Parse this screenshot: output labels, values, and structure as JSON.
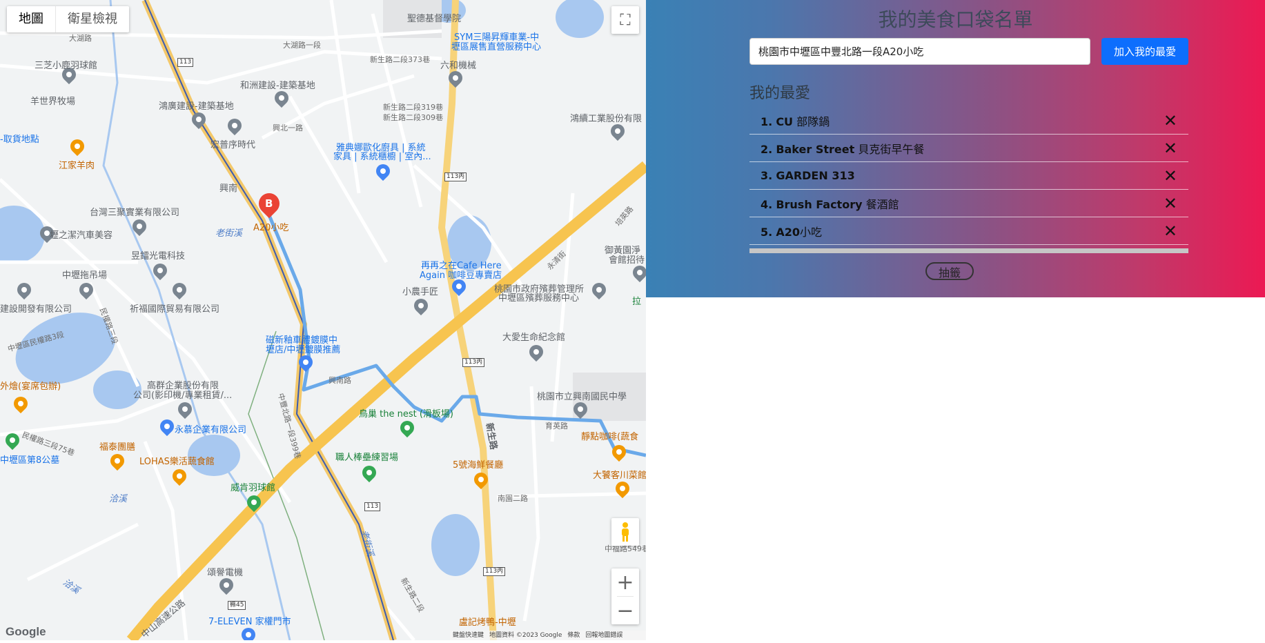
{
  "map": {
    "type_tabs": [
      "地圖",
      "衛星檢視"
    ],
    "fullscreen_label": "⛶",
    "zoom_in": "+",
    "zoom_out": "−",
    "logo": "Google",
    "attribution": [
      "鍵盤快速鍵",
      "地圖資料 ©2023 Google",
      "條款",
      "回報地圖錯誤"
    ],
    "marker_letter": "B",
    "marker_label": "A20小吃",
    "labels": {
      "l1": "聖德基督學院",
      "l2": "SYM三陽昇輝車業-中",
      "l3": "壢區展售直營服務中心",
      "l4": "大湖路一段",
      "l5": "三芝小鹿羽球館",
      "l6": "羊世界牧場",
      "l7": "和洲建設-建築基地",
      "l8": "鴻廣建設-建築基地",
      "l9": "宏普序時代",
      "l10": "-取貨地點",
      "l11": "江家羊肉",
      "l12": "六和機械",
      "l13": "新生路二段373巷",
      "l14": "興北一路",
      "l15": "新生路二段319巷",
      "l16": "新生路二段309巷",
      "l17": "雅典娜歐化廚具 | 系統",
      "l18": "家具 | 系統櫃櫥 | 室內...",
      "l19": "興南",
      "l20": "台灣三聚實業有限公司",
      "l21": "壢之潔汽車美容",
      "l22": "老街溪",
      "l23": "昱鐳光電科技",
      "l24": "中壢拖吊場",
      "l25": "祈福國際貿易有限公司",
      "l26": "建設開發有限公司",
      "l27": "鴻續工業股份有限",
      "l28": "御黃園淨",
      "l29": "會館招待",
      "l30": "再再之在Cafe Here",
      "l31": "Again 咖啡豆專賣店",
      "l32": "小農手匠",
      "l33": "桃園市政府殯葬管理所",
      "l34": "中壢區殯葬服務中心",
      "l35": "拉",
      "l36": "大愛生命紀念館",
      "l37": "磁新釉車體鍍膜中",
      "l38": "壢店/中壢鍍膜推薦",
      "l39": "興南路",
      "l40": "高群企業股份有限",
      "l41": "公司(影印機/專業租賃/...",
      "l42": "鳥巢 the nest (滑板場)",
      "l43": "桃園市立興南國民中學",
      "l44": "靜點咖啡(蔬食",
      "l45": "福泰團膳",
      "l46": "LOHAS樂活蔬食館",
      "l47": "永慕企業有限公司",
      "l48": "中壢區第8公墓",
      "l49": "職人棒壘練習場",
      "l50": "5號海鮮餐廳",
      "l51": "大饕客川菜館",
      "l52": "南園二路",
      "l53": "威肯羽球館",
      "l54": "洽溪",
      "l55": "頌譽電機",
      "l56": "中山高速公路",
      "l57": "7-ELEVEN 家權門市",
      "l58": "盧記烤鴨-中壢",
      "l59": "新生路",
      "l60": "洽溪",
      "l61": "民權路三段",
      "l62": "中壢區民權路3段",
      "l63": "外燴(宴席包辦)",
      "l64": "民權路三段75巷",
      "l65": "中豐北路一段399巷",
      "l66": "老街溪",
      "l67": "育英路",
      "l68": "中福路549巷",
      "l69": "新生路二段",
      "l70": "大湖路",
      "l71": "永清街",
      "l72": "培英路"
    },
    "shields": [
      "113",
      "113丙",
      "113丙",
      "113",
      "113丙",
      "縣45"
    ]
  },
  "panel": {
    "title": "我的美食口袋名單",
    "search_value": "桃園市中壢區中豐北路一段A20小吃",
    "add_button": "加入我的最愛",
    "favorites_heading": "我的最愛",
    "favorites": [
      {
        "num": "1.",
        "name_bold": "CU",
        "name_rest": " 部隊鍋"
      },
      {
        "num": "2.",
        "name_bold": "Baker Street",
        "name_rest": " 貝克街早午餐"
      },
      {
        "num": "3.",
        "name_bold": "GARDEN 313",
        "name_rest": ""
      },
      {
        "num": "4.",
        "name_bold": "Brush Factory",
        "name_rest": " 餐酒館"
      },
      {
        "num": "5.",
        "name_bold": "A20",
        "name_rest": "小吃"
      }
    ],
    "remove_icon": "✕",
    "draw_button": "抽籤"
  }
}
